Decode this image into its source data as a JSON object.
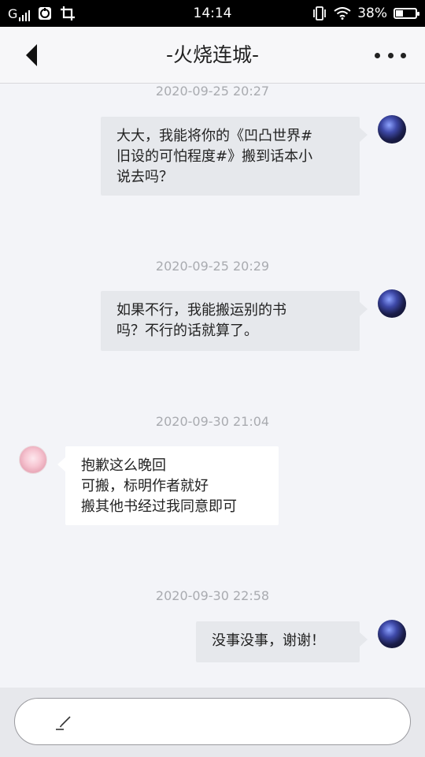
{
  "status_bar": {
    "carrier": "G",
    "time": "14:14",
    "battery_percent": "38%",
    "battery_level": 0.38
  },
  "nav": {
    "title": "-火烧连城-"
  },
  "messages": [
    {
      "timestamp": "2020-09-25 20:27",
      "side": "right",
      "lines": [
        "大大，我能将你的《凹凸世界#",
        "旧设的可怕程度#》搬到话本小",
        "说去吗？"
      ]
    },
    {
      "timestamp": "2020-09-25 20:29",
      "side": "right",
      "lines": [
        "如果不行，我能搬运别的书",
        "吗？不行的话就算了。"
      ]
    },
    {
      "timestamp": "2020-09-30 21:04",
      "side": "left",
      "lines": [
        "抱歉这么晚回",
        "可搬，标明作者就好",
        "搬其他书经过我同意即可"
      ]
    },
    {
      "timestamp": "2020-09-30 22:58",
      "side": "right",
      "lines": [
        "没事没事，谢谢！"
      ]
    }
  ],
  "colors": {
    "background": "#f3f4f8",
    "bubble_right": "#e6e8ec",
    "bubble_left": "#ffffff",
    "timestamp": "#a9abb0"
  }
}
